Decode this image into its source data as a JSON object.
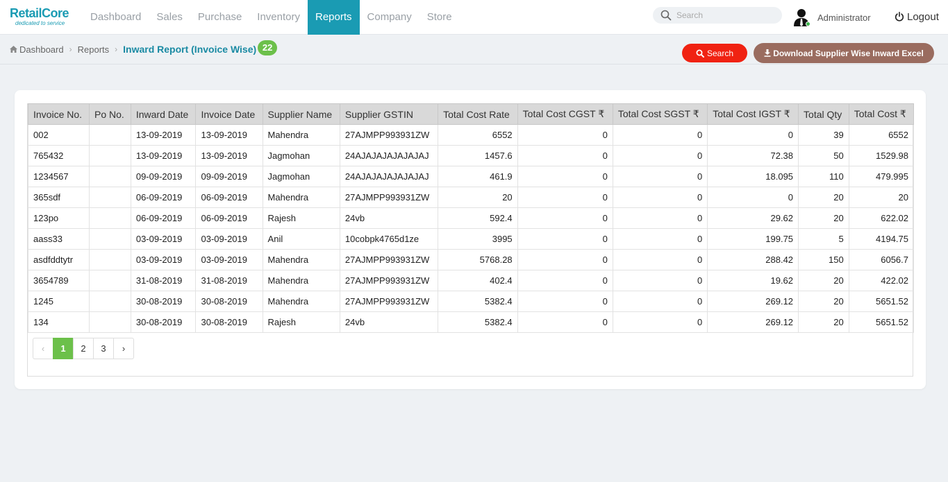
{
  "brand": {
    "name": "RetailCore",
    "tagline": "dedicated to service"
  },
  "nav": [
    {
      "label": "Dashboard",
      "active": false
    },
    {
      "label": "Sales",
      "active": false
    },
    {
      "label": "Purchase",
      "active": false
    },
    {
      "label": "Inventory",
      "active": false
    },
    {
      "label": "Reports",
      "active": true
    },
    {
      "label": "Company",
      "active": false
    },
    {
      "label": "Store",
      "active": false
    }
  ],
  "search": {
    "placeholder": "Search",
    "value": ""
  },
  "user": {
    "name": "Administrator",
    "status_color": "#3bb54a"
  },
  "logout_label": "Logout",
  "breadcrumb": {
    "home": "Dashboard",
    "section": "Reports",
    "current": "Inward Report (Invoice Wise)",
    "count": "22"
  },
  "actions": {
    "search_label": "Search",
    "download_label": "Download Supplier Wise Inward Excel"
  },
  "table": {
    "headers": [
      "Invoice No.",
      "Po No.",
      "Inward Date",
      "Invoice Date",
      "Supplier Name",
      "Supplier GSTIN",
      "Total Cost Rate",
      "Total Cost CGST ₹",
      "Total Cost SGST ₹",
      "Total Cost IGST ₹",
      "Total Qty",
      "Total Cost ₹"
    ],
    "rows": [
      [
        "002",
        "",
        "13-09-2019",
        "13-09-2019",
        "Mahendra",
        "27AJMPP993931ZW",
        "6552",
        "0",
        "0",
        "0",
        "39",
        "6552"
      ],
      [
        "765432",
        "",
        "13-09-2019",
        "13-09-2019",
        "Jagmohan",
        "24AJAJAJAJAJAJAJ",
        "1457.6",
        "0",
        "0",
        "72.38",
        "50",
        "1529.98"
      ],
      [
        "1234567",
        "",
        "09-09-2019",
        "09-09-2019",
        "Jagmohan",
        "24AJAJAJAJAJAJAJ",
        "461.9",
        "0",
        "0",
        "18.095",
        "110",
        "479.995"
      ],
      [
        "365sdf",
        "",
        "06-09-2019",
        "06-09-2019",
        "Mahendra",
        "27AJMPP993931ZW",
        "20",
        "0",
        "0",
        "0",
        "20",
        "20"
      ],
      [
        "123po",
        "",
        "06-09-2019",
        "06-09-2019",
        "Rajesh",
        "24vb",
        "592.4",
        "0",
        "0",
        "29.62",
        "20",
        "622.02"
      ],
      [
        "aass33",
        "",
        "03-09-2019",
        "03-09-2019",
        "Anil",
        "10cobpk4765d1ze",
        "3995",
        "0",
        "0",
        "199.75",
        "5",
        "4194.75"
      ],
      [
        "asdfddtytr",
        "",
        "03-09-2019",
        "03-09-2019",
        "Mahendra",
        "27AJMPP993931ZW",
        "5768.28",
        "0",
        "0",
        "288.42",
        "150",
        "6056.7"
      ],
      [
        "3654789",
        "",
        "31-08-2019",
        "31-08-2019",
        "Mahendra",
        "27AJMPP993931ZW",
        "402.4",
        "0",
        "0",
        "19.62",
        "20",
        "422.02"
      ],
      [
        "1245",
        "",
        "30-08-2019",
        "30-08-2019",
        "Mahendra",
        "27AJMPP993931ZW",
        "5382.4",
        "0",
        "0",
        "269.12",
        "20",
        "5651.52"
      ],
      [
        "134",
        "",
        "30-08-2019",
        "30-08-2019",
        "Rajesh",
        "24vb",
        "5382.4",
        "0",
        "0",
        "269.12",
        "20",
        "5651.52"
      ]
    ]
  },
  "pagination": {
    "prev": "‹",
    "pages": [
      "1",
      "2",
      "3"
    ],
    "active": "1",
    "next": "›"
  },
  "colors": {
    "accent": "#1a9bb3",
    "badge": "#6cc04a",
    "search_button": "#f02212",
    "download_button": "#9a6c5f"
  }
}
